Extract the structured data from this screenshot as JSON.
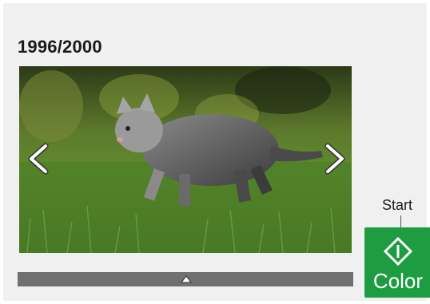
{
  "counter": {
    "text": "1996/2000"
  },
  "photo": {
    "subject_icon": "kitten-photo"
  },
  "navigation": {
    "prev_icon": "chevron-left-icon",
    "next_icon": "chevron-right-icon"
  },
  "scroll": {
    "icon": "triangle-up-icon"
  },
  "start": {
    "label": "Start",
    "button_label": "Color",
    "button_color": "#1e9c42",
    "icon": "start-diamond-icon"
  }
}
